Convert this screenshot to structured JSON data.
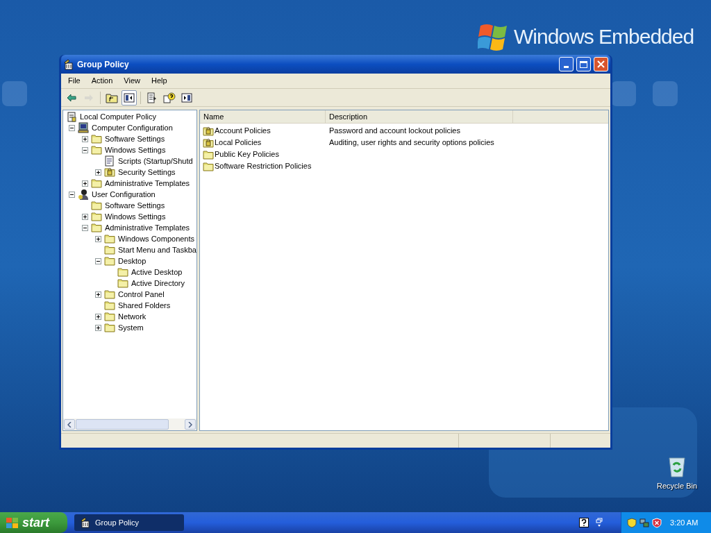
{
  "desktop": {
    "logo": {
      "brand": "Windows",
      "product": "Embedded"
    },
    "icons": [
      {
        "label": "Recycle Bin"
      }
    ]
  },
  "window": {
    "title": "Group Policy",
    "menu": [
      {
        "label": "File"
      },
      {
        "label": "Action"
      },
      {
        "label": "View"
      },
      {
        "label": "Help"
      }
    ],
    "toolbar": [
      {
        "kind": "back",
        "disabled": false,
        "pressed": false
      },
      {
        "kind": "forward",
        "disabled": true,
        "pressed": false
      },
      {
        "kind": "up",
        "disabled": false,
        "pressed": false
      },
      {
        "kind": "tree",
        "disabled": false,
        "pressed": true
      },
      {
        "kind": "export",
        "disabled": false,
        "pressed": false
      },
      {
        "kind": "help",
        "disabled": false,
        "pressed": false
      },
      {
        "kind": "pane",
        "disabled": false,
        "pressed": false
      }
    ],
    "tree": [
      {
        "label": "Local Computer Policy",
        "kind": "policy",
        "children": [
          {
            "label": "Computer Configuration",
            "kind": "computer",
            "expanded": true,
            "children": [
              {
                "label": "Software Settings",
                "kind": "folder",
                "expanded": false
              },
              {
                "label": "Windows Settings",
                "kind": "folder",
                "expanded": true,
                "children": [
                  {
                    "label": "Scripts (Startup/Shutd",
                    "kind": "script"
                  },
                  {
                    "label": "Security Settings",
                    "kind": "secure",
                    "expanded": false
                  }
                ]
              },
              {
                "label": "Administrative Templates",
                "kind": "folder",
                "expanded": false
              }
            ]
          },
          {
            "label": "User Configuration",
            "kind": "user",
            "expanded": true,
            "children": [
              {
                "label": "Software Settings",
                "kind": "folder"
              },
              {
                "label": "Windows Settings",
                "kind": "folder",
                "expanded": false
              },
              {
                "label": "Administrative Templates",
                "kind": "folder",
                "expanded": true,
                "children": [
                  {
                    "label": "Windows Components",
                    "kind": "folder",
                    "expanded": false
                  },
                  {
                    "label": "Start Menu and Taskba",
                    "kind": "folder"
                  },
                  {
                    "label": "Desktop",
                    "kind": "folder",
                    "expanded": true,
                    "children": [
                      {
                        "label": "Active Desktop",
                        "kind": "folder"
                      },
                      {
                        "label": "Active Directory",
                        "kind": "folder"
                      }
                    ]
                  },
                  {
                    "label": "Control Panel",
                    "kind": "folder",
                    "expanded": false
                  },
                  {
                    "label": "Shared Folders",
                    "kind": "folder"
                  },
                  {
                    "label": "Network",
                    "kind": "folder",
                    "expanded": false
                  },
                  {
                    "label": "System",
                    "kind": "folder",
                    "expanded": false
                  }
                ]
              }
            ]
          }
        ]
      }
    ],
    "list": {
      "columns": [
        "Name",
        "Description"
      ],
      "rows": [
        {
          "name": "Account Policies",
          "kind": "secure",
          "description": "Password and account lockout policies"
        },
        {
          "name": "Local Policies",
          "kind": "secure",
          "description": "Auditing, user rights and security options policies"
        },
        {
          "name": "Public Key Policies",
          "kind": "folder"
        },
        {
          "name": "Software Restriction Policies",
          "kind": "folder"
        }
      ]
    }
  },
  "taskbar": {
    "start": "start",
    "tasks": [
      {
        "label": "Group Policy",
        "selected": false
      }
    ],
    "clock": "3:20 AM"
  }
}
